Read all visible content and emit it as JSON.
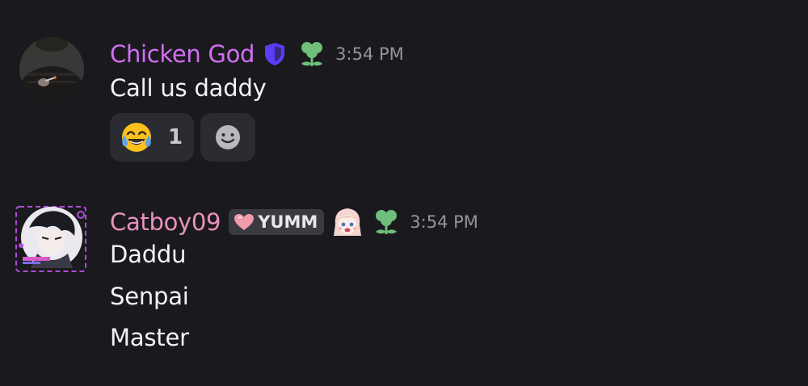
{
  "messages": [
    {
      "username": "Chicken God",
      "username_color": "#d56ef5",
      "time": "3:54 PM",
      "lines": [
        "Call us daddy"
      ],
      "reactions": [
        {
          "emoji": "tears-of-joy-emoji",
          "count": "1"
        }
      ]
    },
    {
      "username": "Catboy09",
      "username_color": "#e991bb",
      "guild_tag": "YUMM",
      "time": "3:54 PM",
      "lines": [
        "Daddu",
        "Senpai",
        "Master"
      ]
    }
  ],
  "colors": {
    "background": "#1a1a1e",
    "reaction_bg": "#2b2c31",
    "shield": "#5a3df5",
    "flower_badge": "#6fbf7a",
    "timestamp": "#94959c"
  }
}
